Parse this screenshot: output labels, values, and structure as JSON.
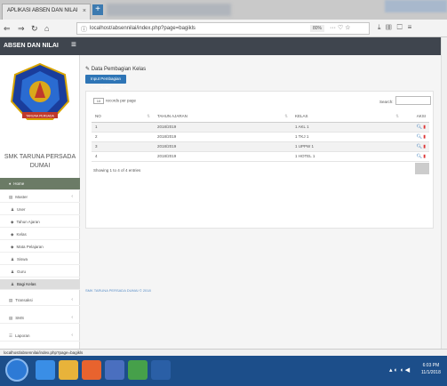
{
  "browser": {
    "tab_title": "APLIKASI ABSEN DAN NILAI",
    "tab_close": "×",
    "new_tab": "+",
    "url": "localhost/absennilai/index.php?page=bagikls",
    "zoom": "80%",
    "more": "··· ♡ ☆",
    "status_url": "localhost/absennilai/index.php?page=bagikls"
  },
  "app": {
    "brand": "ABSEN DAN NILAI",
    "menu_icon": "≡",
    "logo_text": "TARUNA PERSADA"
  },
  "sidebar": {
    "school_name_line1": "SMK TARUNA PERSADA",
    "school_name_line2": "DUMAI",
    "items": [
      {
        "label": "Home",
        "icon": "♦"
      },
      {
        "label": "Master",
        "icon": "▤",
        "chevron": "‹"
      },
      {
        "label": "User",
        "icon": "♟"
      },
      {
        "label": "Tahun Ajaran",
        "icon": "◆"
      },
      {
        "label": "Kelas",
        "icon": "◆"
      },
      {
        "label": "Mata Pelajaran",
        "icon": "◆"
      },
      {
        "label": "Siswa",
        "icon": "♟"
      },
      {
        "label": "Guru",
        "icon": "♟"
      },
      {
        "label": "Bagi Kelas",
        "icon": "♟"
      },
      {
        "label": "Transaksi",
        "icon": "▤",
        "chevron": "‹"
      },
      {
        "label": "SMS",
        "icon": "▤",
        "chevron": "‹"
      },
      {
        "label": "Laporan",
        "icon": "☰",
        "chevron": "‹"
      }
    ]
  },
  "main": {
    "panel_title": "Data Pembagian Kelas",
    "input_button": "Input Pembagian Kelas",
    "length_value": "10",
    "length_label": "records per page",
    "search_label": "Search:",
    "columns": [
      "NO",
      "TAHUN AJARAN",
      "KELAS",
      "AKSI"
    ],
    "rows": [
      {
        "no": "1",
        "tahun": "2018/2019",
        "kelas": "1 AKL 1"
      },
      {
        "no": "2",
        "tahun": "2018/2019",
        "kelas": "1 TKJ 1"
      },
      {
        "no": "3",
        "tahun": "2018/2019",
        "kelas": "1 UPPW 1"
      },
      {
        "no": "4",
        "tahun": "2018/2019",
        "kelas": "1 HOTEL 1"
      }
    ],
    "info": "Showing 1 to 4 of 4 entries",
    "footer": "SMK TARUNA PERSADA DUMAI © 2018"
  },
  "taskbar": {
    "tray": "▴ ◐ ◖ ◀",
    "time": "6:03 PM",
    "date": "11/1/2018"
  },
  "colors": {
    "header": "#3f454e",
    "home_active": "#6b7b66",
    "primary": "#2e75b6",
    "taskbar": "#1c4e8a"
  }
}
